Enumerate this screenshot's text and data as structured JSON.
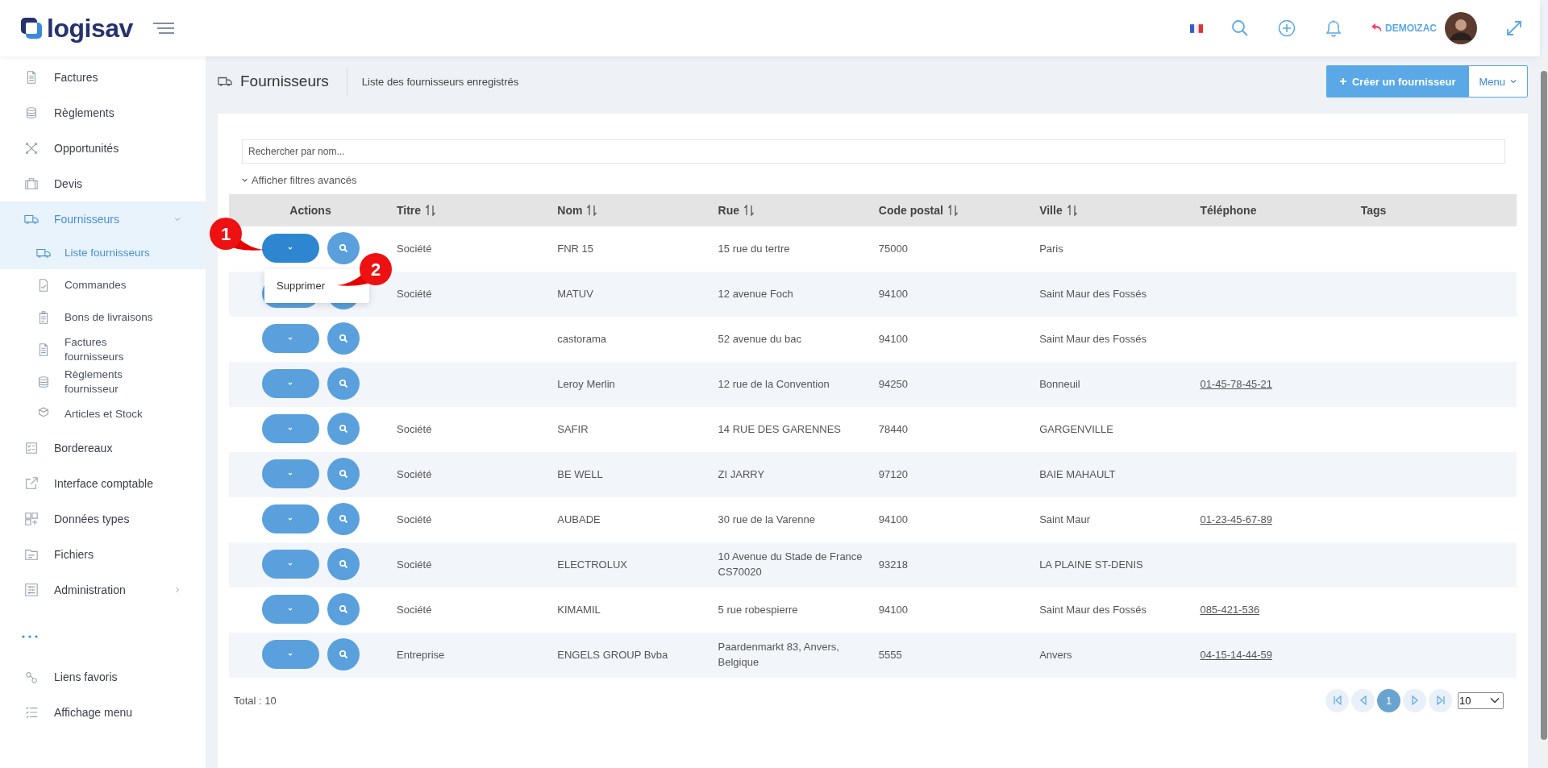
{
  "topbar": {
    "brand": "logisav",
    "user": "DEMO\\ZAC"
  },
  "sidebar": {
    "items": [
      {
        "label": "Factures",
        "selected": false
      },
      {
        "label": "Règlements",
        "selected": false
      },
      {
        "label": "Opportunités",
        "selected": false
      },
      {
        "label": "Devis",
        "selected": false
      },
      {
        "label": "Fournisseurs",
        "selected": false,
        "expanded": true,
        "children": [
          {
            "label": "Liste fournisseurs",
            "selected": true
          },
          {
            "label": "Commandes",
            "selected": false
          },
          {
            "label": "Bons de livraisons",
            "selected": false
          },
          {
            "label": "Factures fournisseurs",
            "selected": false
          },
          {
            "label": "Règlements fournisseur",
            "selected": false
          },
          {
            "label": "Articles et Stock",
            "selected": false
          }
        ]
      },
      {
        "label": "Bordereaux",
        "selected": false
      },
      {
        "label": "Interface comptable",
        "selected": false
      },
      {
        "label": "Données types",
        "selected": false
      },
      {
        "label": "Fichiers",
        "selected": false
      },
      {
        "label": "Administration",
        "selected": false,
        "expanded": false
      }
    ],
    "bottom_items": [
      {
        "label": "Liens favoris",
        "selected": false
      },
      {
        "label": "Affichage menu",
        "selected": false
      }
    ]
  },
  "page": {
    "title": "Fournisseurs",
    "subtitle": "Liste des fournisseurs enregistrés",
    "create_button": "Créer un fournisseur",
    "menu_button": "Menu"
  },
  "search": {
    "placeholder": "Rechercher par nom..."
  },
  "filters_toggle": "Afficher filtres avancés",
  "table": {
    "columns": [
      {
        "label": "Actions",
        "sortable": false
      },
      {
        "label": "Titre",
        "sortable": true
      },
      {
        "label": "Nom",
        "sortable": true
      },
      {
        "label": "Rue",
        "sortable": true
      },
      {
        "label": "Code postal",
        "sortable": true
      },
      {
        "label": "Ville",
        "sortable": true
      },
      {
        "label": "Téléphone",
        "sortable": false
      },
      {
        "label": "Tags",
        "sortable": false
      }
    ],
    "row_menu": [
      "Supprimer"
    ],
    "rows": [
      {
        "menu_open": true,
        "titre": "Société",
        "nom": "FNR 15",
        "rue": "15 rue du tertre",
        "code_postal": "75000",
        "ville": "Paris"
      },
      {
        "menu_open": false,
        "titre": "Société",
        "nom": "MATUV",
        "rue": "12 avenue Foch",
        "code_postal": "94100",
        "ville": "Saint Maur des Fossés"
      },
      {
        "menu_open": false,
        "nom": "castorama",
        "rue": "52 avenue du bac",
        "code_postal": "94100",
        "ville": "Saint Maur des Fossés"
      },
      {
        "menu_open": false,
        "nom": "Leroy Merlin",
        "rue": "12 rue de la Convention",
        "code_postal": "94250",
        "ville": "Bonneuil",
        "telephone": "01-45-78-45-21"
      },
      {
        "menu_open": false,
        "titre": "Société",
        "nom": "SAFIR",
        "rue": "14 RUE DES GARENNES",
        "code_postal": "78440",
        "ville": "GARGENVILLE"
      },
      {
        "menu_open": false,
        "titre": "Société",
        "nom": "BE WELL",
        "rue": "ZI JARRY",
        "code_postal": "97120",
        "ville": "BAIE MAHAULT"
      },
      {
        "menu_open": false,
        "titre": "Société",
        "nom": "AUBADE",
        "rue": "30 rue de la Varenne",
        "code_postal": "94100",
        "ville": "Saint Maur",
        "telephone": "01-23-45-67-89"
      },
      {
        "menu_open": false,
        "titre": "Société",
        "nom": "ELECTROLUX",
        "rue": "10 Avenue du Stade de France CS70020",
        "code_postal": "93218",
        "ville": "LA PLAINE ST-DENIS"
      },
      {
        "menu_open": false,
        "titre": "Société",
        "nom": "KIMAMIL",
        "rue": "5 rue robespierre",
        "code_postal": "94100",
        "ville": "Saint Maur des Fossés",
        "telephone": "085-421-536"
      },
      {
        "menu_open": false,
        "titre": "Entreprise",
        "nom": "ENGELS GROUP Bvba",
        "rue": "Paardenmarkt 83, Anvers, Belgique",
        "code_postal": "5555",
        "ville": "Anvers",
        "telephone": "04-15-14-44-59"
      }
    ]
  },
  "total": "Total : 10",
  "pagination": {
    "pages": [
      {
        "label": "1",
        "selected": true
      }
    ],
    "page_size": "10"
  },
  "annotations": [
    {
      "label": "1"
    },
    {
      "label": "2"
    }
  ]
}
